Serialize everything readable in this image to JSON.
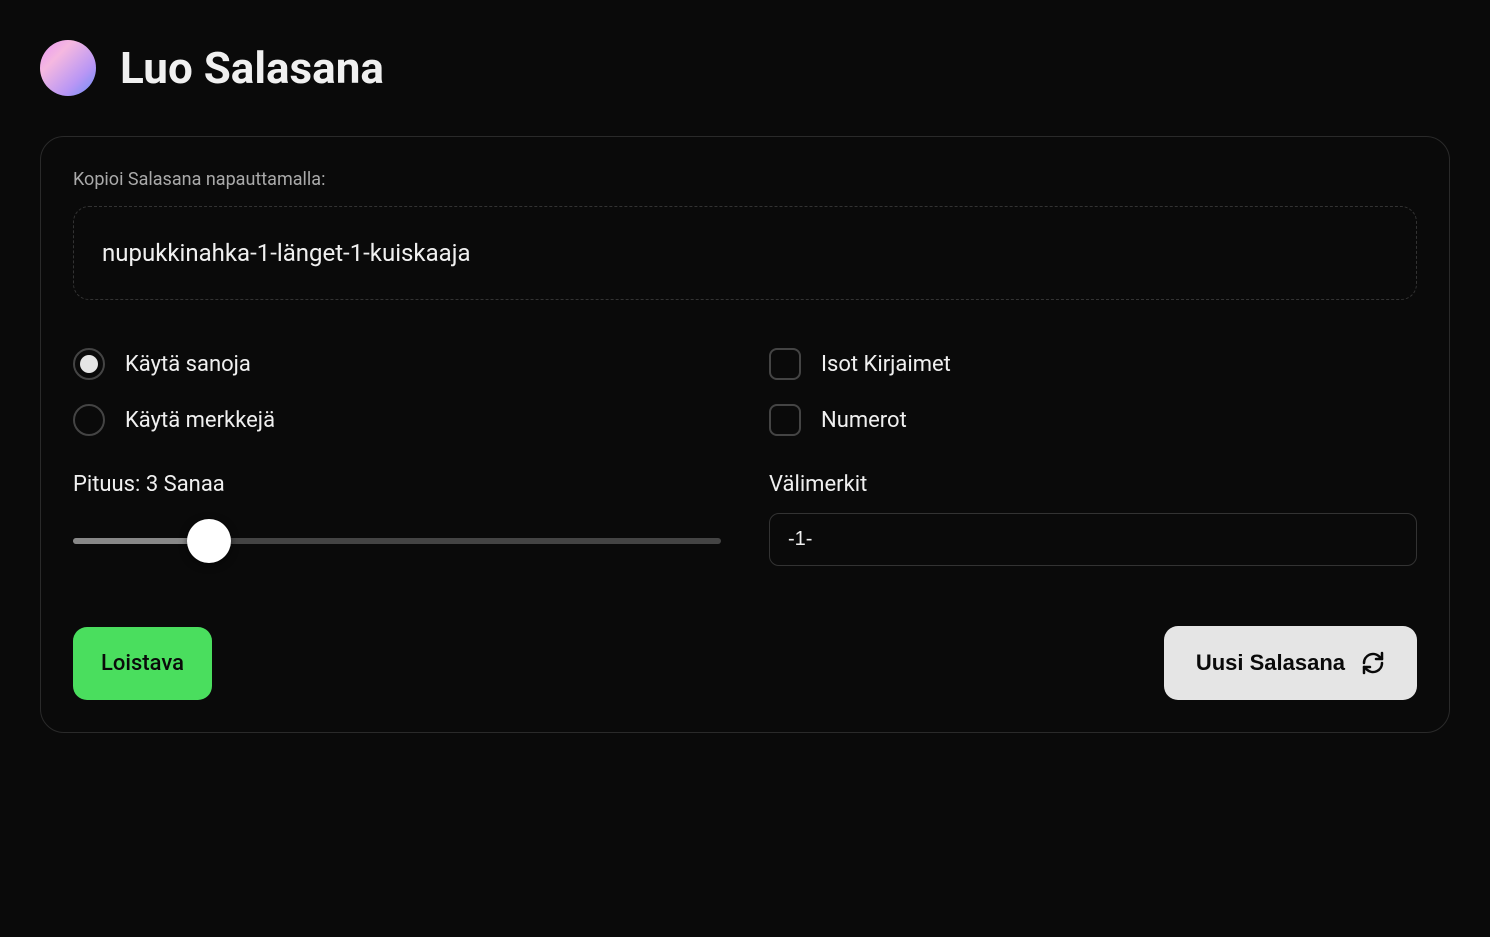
{
  "header": {
    "title": "Luo Salasana"
  },
  "card": {
    "copy_label": "Kopioi Salasana napauttamalla:",
    "password": "nupukkinahka-1-länget-1-kuiskaaja",
    "options": {
      "use_words": {
        "label": "Käytä sanoja",
        "selected": true
      },
      "use_chars": {
        "label": "Käytä merkkejä",
        "selected": false
      },
      "uppercase": {
        "label": "Isot Kirjaimet",
        "checked": false
      },
      "numbers": {
        "label": "Numerot",
        "checked": false
      }
    },
    "slider": {
      "label": "Pituus: 3 Sanaa",
      "value": 3,
      "min": 1,
      "max": 12
    },
    "delimiter": {
      "label": "Välimerkit",
      "value": "-1-"
    },
    "strength": {
      "label": "Loistava",
      "color": "#4ade5e"
    },
    "generate_button": {
      "label": "Uusi Salasana"
    }
  }
}
